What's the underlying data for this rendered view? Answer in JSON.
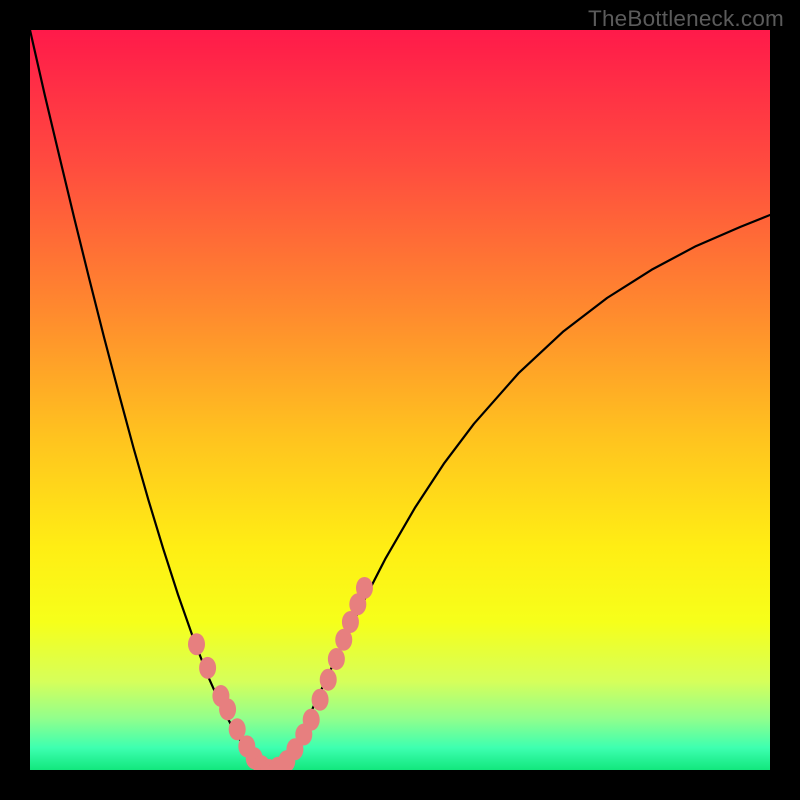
{
  "watermark": "TheBottleneck.com",
  "colors": {
    "frame": "#000000",
    "gradient_stops": [
      {
        "offset": 0.0,
        "color": "#ff1a4a"
      },
      {
        "offset": 0.18,
        "color": "#ff4b3f"
      },
      {
        "offset": 0.38,
        "color": "#ff8a2e"
      },
      {
        "offset": 0.55,
        "color": "#ffc31f"
      },
      {
        "offset": 0.7,
        "color": "#ffee14"
      },
      {
        "offset": 0.8,
        "color": "#f6ff1a"
      },
      {
        "offset": 0.88,
        "color": "#d6ff5a"
      },
      {
        "offset": 0.93,
        "color": "#92ff8c"
      },
      {
        "offset": 0.97,
        "color": "#3dffb0"
      },
      {
        "offset": 1.0,
        "color": "#12e77d"
      }
    ],
    "curve": "#000000",
    "marker_fill": "#e77f7f",
    "marker_stroke": "#d86a6a"
  },
  "chart_data": {
    "type": "line",
    "title": "",
    "xlabel": "",
    "ylabel": "",
    "x": [
      0.0,
      0.02,
      0.04,
      0.06,
      0.08,
      0.1,
      0.12,
      0.14,
      0.16,
      0.18,
      0.2,
      0.22,
      0.24,
      0.26,
      0.28,
      0.3,
      0.305,
      0.31,
      0.32,
      0.34,
      0.36,
      0.38,
      0.4,
      0.44,
      0.48,
      0.52,
      0.56,
      0.6,
      0.66,
      0.72,
      0.78,
      0.84,
      0.9,
      0.96,
      1.0
    ],
    "values": [
      1.0,
      0.912,
      0.828,
      0.745,
      0.664,
      0.585,
      0.509,
      0.435,
      0.365,
      0.299,
      0.237,
      0.18,
      0.128,
      0.083,
      0.046,
      0.018,
      0.009,
      0.004,
      0.0,
      0.012,
      0.04,
      0.079,
      0.122,
      0.207,
      0.285,
      0.354,
      0.415,
      0.468,
      0.536,
      0.592,
      0.638,
      0.676,
      0.708,
      0.734,
      0.75
    ],
    "xlim": [
      0,
      1
    ],
    "ylim": [
      0,
      1
    ],
    "markers": [
      {
        "x": 0.225,
        "y": 0.17
      },
      {
        "x": 0.24,
        "y": 0.138
      },
      {
        "x": 0.258,
        "y": 0.1
      },
      {
        "x": 0.267,
        "y": 0.082
      },
      {
        "x": 0.28,
        "y": 0.055
      },
      {
        "x": 0.293,
        "y": 0.032
      },
      {
        "x": 0.303,
        "y": 0.016
      },
      {
        "x": 0.313,
        "y": 0.005
      },
      {
        "x": 0.323,
        "y": 0.0
      },
      {
        "x": 0.335,
        "y": 0.003
      },
      {
        "x": 0.347,
        "y": 0.012
      },
      {
        "x": 0.358,
        "y": 0.028
      },
      {
        "x": 0.37,
        "y": 0.048
      },
      {
        "x": 0.38,
        "y": 0.068
      },
      {
        "x": 0.392,
        "y": 0.095
      },
      {
        "x": 0.403,
        "y": 0.122
      },
      {
        "x": 0.414,
        "y": 0.15
      },
      {
        "x": 0.424,
        "y": 0.176
      },
      {
        "x": 0.433,
        "y": 0.2
      },
      {
        "x": 0.443,
        "y": 0.224
      },
      {
        "x": 0.452,
        "y": 0.246
      }
    ]
  }
}
